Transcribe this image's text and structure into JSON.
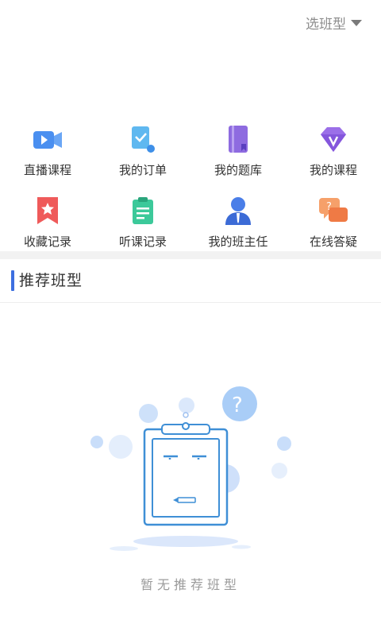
{
  "header": {
    "class_select_label": "选班型"
  },
  "menu": {
    "items": [
      {
        "label": "直播课程",
        "icon": "live-video-icon"
      },
      {
        "label": "我的订单",
        "icon": "order-check-icon"
      },
      {
        "label": "我的题库",
        "icon": "question-bank-icon"
      },
      {
        "label": "我的课程",
        "icon": "diamond-course-icon"
      },
      {
        "label": "收藏记录",
        "icon": "bookmark-star-icon"
      },
      {
        "label": "听课记录",
        "icon": "clipboard-record-icon"
      },
      {
        "label": "我的班主任",
        "icon": "head-teacher-icon"
      },
      {
        "label": "在线答疑",
        "icon": "chat-question-icon"
      }
    ]
  },
  "section": {
    "title": "推荐班型"
  },
  "empty_state": {
    "message": "暂无推荐班型",
    "icon": "empty-clipboard-illustration"
  },
  "colors": {
    "accent_bar": "#3d6fe0",
    "icon_blue": "#4a8ff0",
    "icon_purple": "#8e6be0",
    "icon_red": "#ef5a5a",
    "icon_green": "#3cc99a",
    "icon_orange": "#f08a4a"
  }
}
